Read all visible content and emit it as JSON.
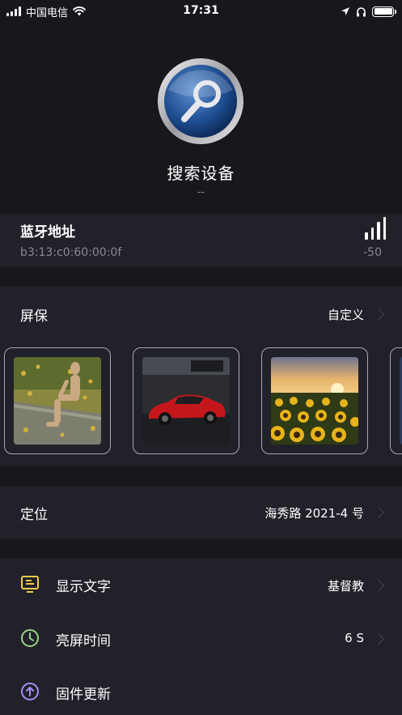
{
  "status_bar": {
    "carrier": "中国电信",
    "time": "17:31"
  },
  "device": {
    "title": "搜索设备",
    "subtitle": "--",
    "logo_icon": "magnifier-icon"
  },
  "bluetooth": {
    "title": "蓝牙地址",
    "address": "b3:13:c0:60:00:0f",
    "rssi": "-50",
    "signal_bars": 4
  },
  "screensaver": {
    "label": "屏保",
    "value": "自定义",
    "images": [
      {
        "name": "wooden-mannequin-on-leaves"
      },
      {
        "name": "red-sports-car"
      },
      {
        "name": "sunflower-field-sunset"
      }
    ]
  },
  "location": {
    "label": "定位",
    "value": "海秀路 2021-4 号"
  },
  "menu": {
    "items": [
      {
        "icon": "display-text-icon",
        "label": "显示文字",
        "value": "基督教",
        "color": "#f2c94c"
      },
      {
        "icon": "clock-icon",
        "label": "亮屏时间",
        "value": "6 S",
        "color": "#9bd48a"
      },
      {
        "icon": "upload-icon",
        "label": "固件更新",
        "value": "",
        "color": "#a58cf0"
      }
    ]
  },
  "colors": {
    "background": "#17171c",
    "card": "#21212a",
    "secondary_text": "#8a8a92"
  }
}
